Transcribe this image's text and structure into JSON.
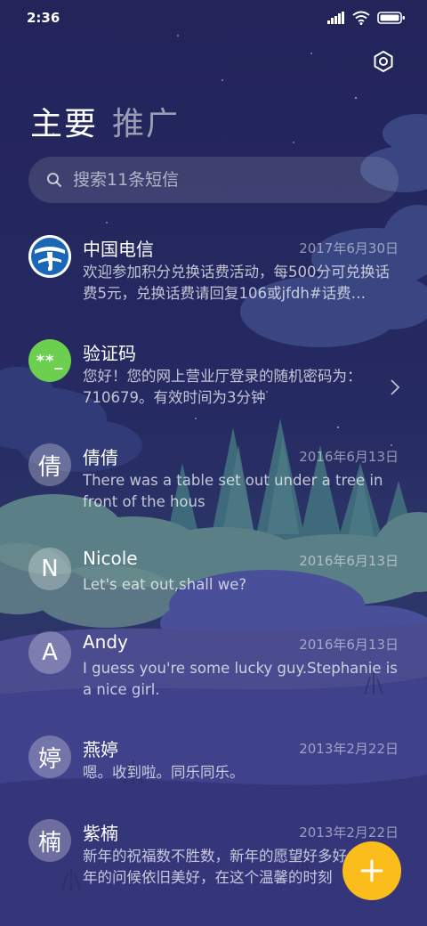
{
  "status_bar": {
    "time": "2:36"
  },
  "tabs": [
    {
      "label": "主要"
    },
    {
      "label": "推广"
    }
  ],
  "search": {
    "placeholder": "搜索11条短信"
  },
  "conversations": [
    {
      "name": "中国电信",
      "date": "2017年6月30日",
      "preview": "欢迎参加积分兑换话费活动，每500分可兑换话费5元，兑换话费请回复106或jfdh#话费…",
      "avatar": "telecom-logo"
    },
    {
      "name": "验证码",
      "date": "",
      "preview": "您好！您的网上营业厅登录的随机密码为：710679。有效时间为3分钟",
      "avatar_text": "**_"
    },
    {
      "name": "倩倩",
      "date": "2016年6月13日",
      "preview": "There was a table set out under a tree in front of the hous",
      "avatar_text": "倩"
    },
    {
      "name": "Nicole",
      "date": "2016年6月13日",
      "preview": "Let's eat out,shall we?",
      "avatar_text": "N"
    },
    {
      "name": "Andy",
      "date": "2016年6月13日",
      "preview": "I guess you're some lucky guy.Stephanie is a nice girl.",
      "avatar_text": "A"
    },
    {
      "name": "燕婷",
      "date": "2013年2月22日",
      "preview": "嗯。收到啦。同乐同乐。",
      "avatar_text": "婷"
    },
    {
      "name": "紫楠",
      "date": "2013年2月22日",
      "preview": "新年的祝福数不胜数，新年的愿望好多好多，新年的问候依旧美好，在这个温馨的时刻",
      "avatar_text": "楠"
    }
  ],
  "colors": {
    "accent": "#fbbd1c",
    "verification_avatar": "#6ccf4f",
    "background": "#25285a"
  }
}
